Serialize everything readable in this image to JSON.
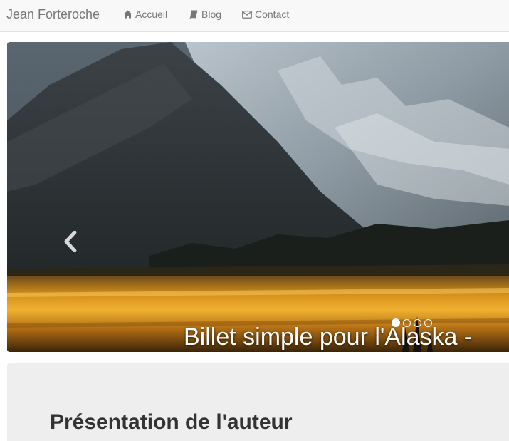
{
  "navbar": {
    "brand": "Jean Forteroche",
    "links": [
      {
        "label": "Accueil",
        "icon": "home-icon"
      },
      {
        "label": "Blog",
        "icon": "book-icon"
      },
      {
        "label": "Contact",
        "icon": "envelope-icon"
      }
    ]
  },
  "carousel": {
    "caption": "Billet simple pour l'Alaska -",
    "prev_icon": "chevron-left-icon",
    "slides_count": 4,
    "active_slide": 1
  },
  "jumbotron": {
    "title": "Présentation de l'auteur"
  },
  "colors": {
    "navbar_bg": "#f8f8f8",
    "nav_text": "#777777",
    "jumbotron_bg": "#eeeeee",
    "title_text": "#333333",
    "sunset_gold": "#e8a020"
  }
}
